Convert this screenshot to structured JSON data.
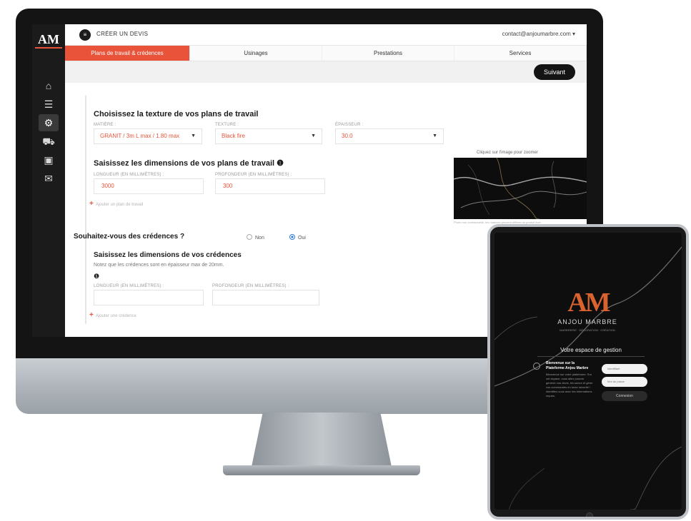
{
  "app": {
    "logo_text": "AM",
    "create_label": "CRÉER UN DEVIS",
    "user_menu": "contact@anjoumarbre.com ▾"
  },
  "sidebar": {
    "icons": [
      "home-icon",
      "list-icon",
      "settings-icon",
      "truck-icon",
      "id-card-icon",
      "chat-icon"
    ]
  },
  "tabs": [
    {
      "label": "Plans de travail & crédences",
      "active": true
    },
    {
      "label": "Usinages",
      "active": false
    },
    {
      "label": "Prestations",
      "active": false
    },
    {
      "label": "Services",
      "active": false
    }
  ],
  "toolbar": {
    "next_label": "Suivant"
  },
  "texture_section": {
    "title": "Choisissez la texture de vos plans de travail",
    "material_label": "MATIÈRE :",
    "material_value": "GRANIT / 3m L max / 1.80 max",
    "texture_label": "TEXTURE :",
    "texture_value": "Black fire",
    "thickness_label": "ÉPAISSEUR :",
    "thickness_value": "30.0"
  },
  "dimensions_section": {
    "title": "Saisissez les dimensions de vos plans de travail ❶",
    "length_label": "LONGUEUR (en millimètres) :",
    "length_value": "3000",
    "depth_label": "PROFONDEUR (en millimètres) :",
    "depth_value": "300",
    "add_label": "Ajouter un plan de travail"
  },
  "image_panel": {
    "zoom_caption": "Cliquez sur l'image pour zoomer",
    "caption": "Photo non contractuelle, les nuances peuvent différer du produit livré."
  },
  "credence_question": {
    "label": "Souhaitez-vous des crédences ?",
    "option_no": "Non",
    "option_yes": "Oui",
    "selected": "Oui"
  },
  "credence_section": {
    "title": "Saisissez les dimensions de vos crédences",
    "note": "Notez que les crédences sont en épaisseur max de 20mm.",
    "info_mark": "❶",
    "length_label": "LONGUEUR (en millimètres) :",
    "depth_label": "PROFONDEUR (en millimètres) :",
    "add_label": "Ajouter une crédence"
  },
  "tablet": {
    "logo_text": "AM",
    "brand_name": "ANJOU MARBRE",
    "brand_sub": "MARBRERIE · DÉCORATION · CRÉATION",
    "heading": "Votre espace de gestion",
    "welcome_title": "Bienvenue sur la Plateforme Anjou Marbre",
    "welcome_desc": "Bienvenue sur votre plateforme. Sur cet espace, vous allez pouvoir générer vos devis, les suivre et gérer vos commandes en toute sécurité ! Identifiez-vous avec les informations reçues.",
    "email_placeholder": "Identifiant",
    "password_placeholder": "Mot de passe",
    "connect_label": "Connexion"
  }
}
